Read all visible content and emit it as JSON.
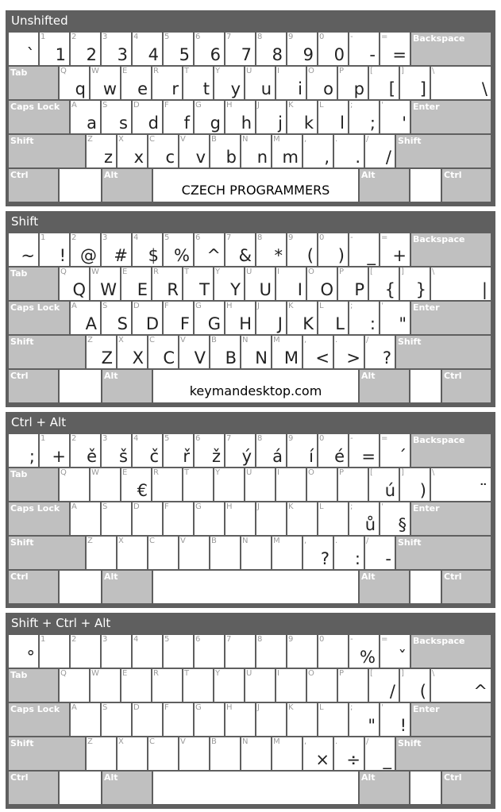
{
  "modifier_labels": {
    "tab": "Tab",
    "caps": "Caps Lock",
    "shift": "Shift",
    "ctrl": "Ctrl",
    "alt": "Alt",
    "backspace": "Backspace",
    "enter": "Enter"
  },
  "key_labels": {
    "row1": [
      "",
      "1",
      "2",
      "3",
      "4",
      "5",
      "6",
      "7",
      "8",
      "9",
      "0",
      "-",
      "="
    ],
    "row2": [
      "Q",
      "W",
      "E",
      "R",
      "T",
      "Y",
      "U",
      "I",
      "O",
      "P",
      "[",
      "]",
      "\\"
    ],
    "row3": [
      "A",
      "S",
      "D",
      "F",
      "G",
      "H",
      "J",
      "K",
      "L",
      ";",
      "'"
    ],
    "row4": [
      "Z",
      "X",
      "C",
      "V",
      "B",
      "N",
      "M",
      ",",
      ".",
      "/"
    ]
  },
  "layers": [
    {
      "title": "Unshifted",
      "space_text": "CZECH PROGRAMMERS",
      "row1": [
        "`",
        "1",
        "2",
        "3",
        "4",
        "5",
        "6",
        "7",
        "8",
        "9",
        "0",
        "-",
        "="
      ],
      "row2": [
        "q",
        "w",
        "e",
        "r",
        "t",
        "y",
        "u",
        "i",
        "o",
        "p",
        "[",
        "]",
        "\\"
      ],
      "row3": [
        "a",
        "s",
        "d",
        "f",
        "g",
        "h",
        "j",
        "k",
        "l",
        ";",
        "'"
      ],
      "row4": [
        "z",
        "x",
        "c",
        "v",
        "b",
        "n",
        "m",
        ",",
        ".",
        "/"
      ]
    },
    {
      "title": "Shift",
      "space_text": "keymandesktop.com",
      "row1": [
        "~",
        "!",
        "@",
        "#",
        "$",
        "%",
        "^",
        "&",
        "*",
        "(",
        ")",
        "_",
        "+"
      ],
      "row2": [
        "Q",
        "W",
        "E",
        "R",
        "T",
        "Y",
        "U",
        "I",
        "O",
        "P",
        "{",
        "}",
        "|"
      ],
      "row3": [
        "A",
        "S",
        "D",
        "F",
        "G",
        "H",
        "J",
        "K",
        "L",
        ":",
        "\""
      ],
      "row4": [
        "Z",
        "X",
        "C",
        "V",
        "B",
        "N",
        "M",
        "<",
        ">",
        "?"
      ]
    },
    {
      "title": "Ctrl + Alt",
      "space_text": "",
      "row1": [
        ";",
        "+",
        "ě",
        "š",
        "č",
        "ř",
        "ž",
        "ý",
        "á",
        "í",
        "é",
        "=",
        "´"
      ],
      "row2": [
        "",
        "",
        "€",
        "",
        "",
        "",
        "",
        "",
        "",
        "",
        "ú",
        ")",
        "¨"
      ],
      "row3": [
        "",
        "",
        "",
        "",
        "",
        "",
        "",
        "",
        "",
        "ů",
        "§"
      ],
      "row4": [
        "",
        "",
        "",
        "",
        "",
        "",
        "",
        "?",
        ":",
        "-"
      ]
    },
    {
      "title": "Shift + Ctrl + Alt",
      "space_text": "",
      "row1": [
        "°",
        "",
        "",
        "",
        "",
        "",
        "",
        "",
        "",
        "",
        "",
        "%",
        "ˇ"
      ],
      "row2": [
        "",
        "",
        "",
        "",
        "",
        "",
        "",
        "",
        "",
        "",
        "/",
        "(",
        "^"
      ],
      "row3": [
        "",
        "",
        "",
        "",
        "",
        "",
        "",
        "",
        "",
        "\"",
        "!"
      ],
      "row4": [
        "",
        "",
        "",
        "",
        "",
        "",
        "",
        "×",
        "÷",
        "_"
      ]
    }
  ]
}
